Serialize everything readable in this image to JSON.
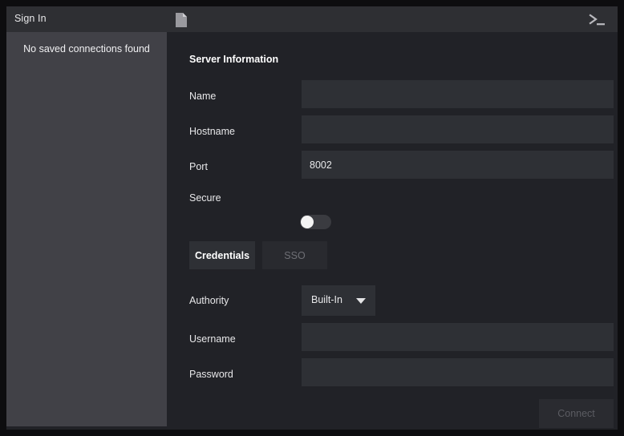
{
  "window": {
    "titlebar": {
      "sign_in_label": "Sign In",
      "doc_icon": "document-icon",
      "terminal_icon": "terminal-icon"
    }
  },
  "sidebar": {
    "empty_message": "No saved connections found"
  },
  "main": {
    "section_title": "Server Information",
    "fields": [
      {
        "label": "Name",
        "value": "",
        "placeholder": ""
      },
      {
        "label": "Hostname",
        "value": "",
        "placeholder": ""
      },
      {
        "label": "Port",
        "value": "8002",
        "placeholder": ""
      }
    ],
    "secure": {
      "label": "Secure",
      "state": "off"
    },
    "tabs": [
      {
        "label": "Credentials",
        "active": true
      },
      {
        "label": "SSO",
        "active": false
      }
    ],
    "authority": {
      "label": "Authority",
      "selected": "Built-In",
      "caret_icon": "chevron-down-icon"
    },
    "credentials": [
      {
        "label": "Username",
        "value": "",
        "placeholder": ""
      },
      {
        "label": "Password",
        "value": "",
        "placeholder": ""
      }
    ],
    "connect": {
      "label": "Connect",
      "enabled": false
    }
  },
  "colors": {
    "window_bg": "#0d0d0f",
    "titlebar_bg": "#2e2f33",
    "sidebar_bg": "#414147",
    "panel_bg": "#212227",
    "input_bg": "#2e3035",
    "text_primary": "#e8e8ea",
    "text_muted": "#6e6f75"
  }
}
